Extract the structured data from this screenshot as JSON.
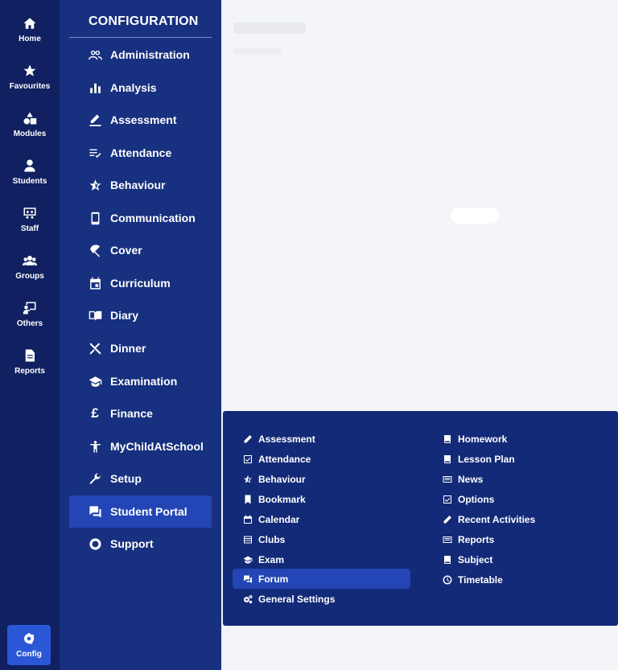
{
  "rail": {
    "items": [
      {
        "label": "Home",
        "icon": "home-icon"
      },
      {
        "label": "Favourites",
        "icon": "star-icon"
      },
      {
        "label": "Modules",
        "icon": "shapes-icon"
      },
      {
        "label": "Students",
        "icon": "user-icon"
      },
      {
        "label": "Staff",
        "icon": "presentation-icon"
      },
      {
        "label": "Groups",
        "icon": "group-icon"
      },
      {
        "label": "Others",
        "icon": "teacher-icon"
      },
      {
        "label": "Reports",
        "icon": "document-icon"
      }
    ],
    "config_label": "Config"
  },
  "config": {
    "title": "CONFIGURATION",
    "items": [
      {
        "label": "Administration"
      },
      {
        "label": "Analysis"
      },
      {
        "label": "Assessment"
      },
      {
        "label": "Attendance"
      },
      {
        "label": "Behaviour"
      },
      {
        "label": "Communication"
      },
      {
        "label": "Cover"
      },
      {
        "label": "Curriculum"
      },
      {
        "label": "Diary"
      },
      {
        "label": "Dinner"
      },
      {
        "label": "Examination"
      },
      {
        "label": "Finance"
      },
      {
        "label": "MyChildAtSchool"
      },
      {
        "label": "Setup"
      },
      {
        "label": "Student Portal"
      },
      {
        "label": "Support"
      }
    ],
    "active": "Student Portal"
  },
  "flyout": {
    "left": [
      {
        "label": "Assessment"
      },
      {
        "label": "Attendance"
      },
      {
        "label": "Behaviour"
      },
      {
        "label": "Bookmark"
      },
      {
        "label": "Calendar"
      },
      {
        "label": "Clubs"
      },
      {
        "label": "Exam"
      },
      {
        "label": "Forum"
      },
      {
        "label": "General Settings"
      }
    ],
    "right": [
      {
        "label": "Homework"
      },
      {
        "label": "Lesson Plan"
      },
      {
        "label": "News"
      },
      {
        "label": "Options"
      },
      {
        "label": "Recent Activities"
      },
      {
        "label": "Reports"
      },
      {
        "label": "Subject"
      },
      {
        "label": "Timetable"
      }
    ],
    "active": "Forum"
  },
  "colors": {
    "rail": "#102060",
    "sidebar": "#17307f",
    "flyout": "#132a78",
    "active": "#2345b5",
    "config_button": "#2a57d6"
  }
}
